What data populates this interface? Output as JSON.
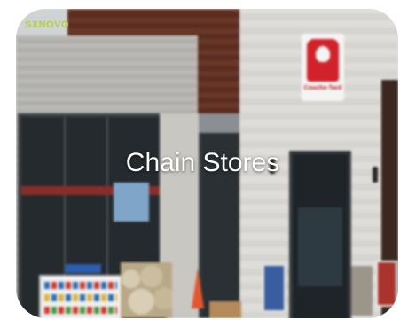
{
  "tile": {
    "title": "Chain Stores",
    "watermark": "SXNOVO",
    "store_sign": "Couche-Tard"
  },
  "colors": {
    "brand_red": "#d1222a",
    "wood": "#5a2d21",
    "watermark_green": "#b5cf3c"
  }
}
